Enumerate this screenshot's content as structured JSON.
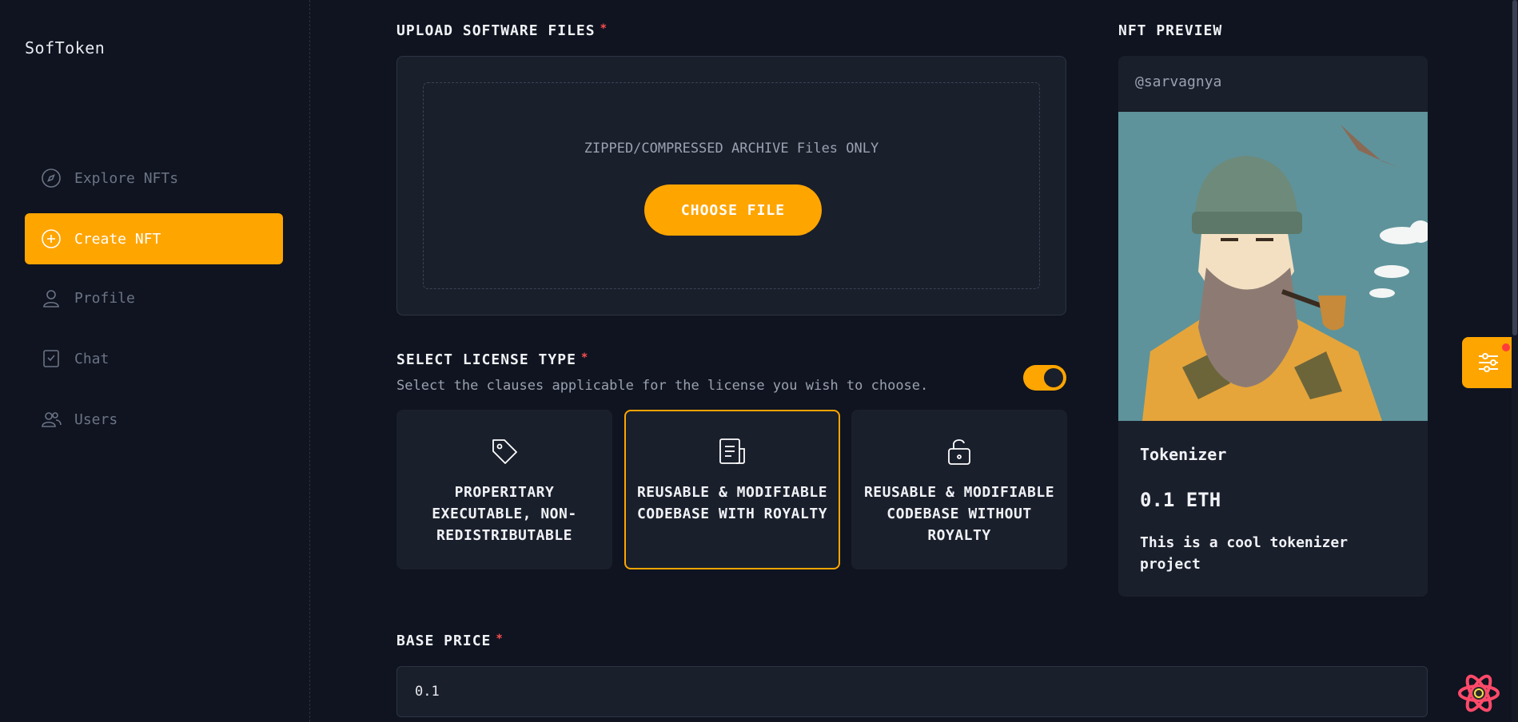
{
  "app": {
    "brand": "SofToken"
  },
  "sidebar": {
    "items": [
      {
        "label": "Explore NFTs",
        "icon": "compass-icon",
        "active": false
      },
      {
        "label": "Create NFT",
        "icon": "plus-circle-icon",
        "active": true
      },
      {
        "label": "Profile",
        "icon": "user-icon",
        "active": false
      },
      {
        "label": "Chat",
        "icon": "chat-icon",
        "active": false
      },
      {
        "label": "Users",
        "icon": "users-icon",
        "active": false
      }
    ]
  },
  "upload": {
    "title": "UPLOAD SOFTWARE FILES",
    "required_mark": "*",
    "hint": "ZIPPED/COMPRESSED ARCHIVE Files ONLY",
    "button_label": "CHOOSE FILE"
  },
  "license": {
    "title": "SELECT LICENSE TYPE",
    "required_mark": "*",
    "subtitle": "Select the clauses applicable for the license you wish to choose.",
    "toggle_on": true,
    "options": [
      {
        "label": "PROPERITARY EXECUTABLE, NON-REDISTRIBUTABLE",
        "icon": "tag-icon",
        "selected": false
      },
      {
        "label": "REUSABLE & MODIFIABLE CODEBASE WITH ROYALTY",
        "icon": "document-icon",
        "selected": true
      },
      {
        "label": "REUSABLE & MODIFIABLE CODEBASE WITHOUT ROYALTY",
        "icon": "unlock-icon",
        "selected": false
      }
    ]
  },
  "price": {
    "title": "BASE PRICE",
    "required_mark": "*",
    "value": "0.1"
  },
  "preview": {
    "title": "NFT PREVIEW",
    "owner": "@sarvagnya",
    "name": "Tokenizer",
    "price": "0.1 ETH",
    "description": "This is a cool tokenizer project"
  },
  "colors": {
    "accent": "#ffa500",
    "background": "#0f1420",
    "card": "#1a1f2c",
    "required": "#ff4d4f"
  }
}
